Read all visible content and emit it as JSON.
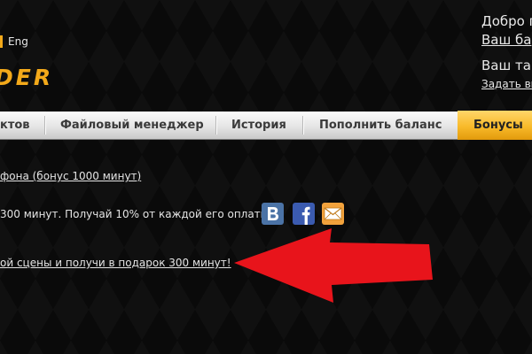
{
  "header": {
    "lang_label": "Eng",
    "logo_text": "DER",
    "greeting": "Добро п",
    "balance_link": "Ваш ба",
    "tariff": "Ваш тар",
    "set_link": "Задать вы"
  },
  "nav": {
    "items": [
      {
        "label": "ктов"
      },
      {
        "label": "Файловый менеджер"
      },
      {
        "label": "История"
      },
      {
        "label": "Пополнить баланс"
      },
      {
        "label": "Бонусы"
      }
    ],
    "active_index": 4
  },
  "content": {
    "line1_link": "фона (бонус 1000 минут)",
    "line2_text": "300 минут. Получай 10% от каждой его оплаты.",
    "line3_link": "ой сцены и получи в подарок 300 минут!",
    "share_icons": [
      "vk-icon",
      "facebook-icon",
      "mail-icon"
    ]
  },
  "colors": {
    "accent_orange": "#f3a91a",
    "vk_blue": "#4b73a6",
    "facebook_blue": "#3b5bb0",
    "mail_orange": "#f2a23c",
    "arrow_red": "#e8141b",
    "nav_bg": "#e5e5e5"
  }
}
